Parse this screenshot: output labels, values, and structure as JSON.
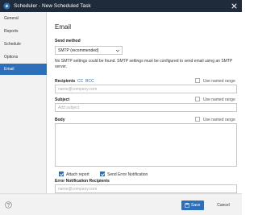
{
  "window": {
    "title": "Scheduler - New Scheduled Task"
  },
  "sidebar": {
    "items": [
      {
        "label": "General",
        "active": false
      },
      {
        "label": "Reports",
        "active": false
      },
      {
        "label": "Schedule",
        "active": false
      },
      {
        "label": "Options",
        "active": false
      },
      {
        "label": "Email",
        "active": true
      }
    ]
  },
  "main": {
    "title": "Email",
    "send_method": {
      "label": "Send method",
      "value": "SMTP (recommended)"
    },
    "warning": "No SMTP settings could be found. SMTP settings must be configured to send email using an SMTP server.",
    "recipients": {
      "label": "Recipients",
      "cc": "CC",
      "bcc": "BCC",
      "placeholder": "name@company.com",
      "named_range": "Use named range"
    },
    "subject": {
      "label": "Subject",
      "placeholder": "Add subject",
      "named_range": "Use named range"
    },
    "body": {
      "label": "Body",
      "named_range": "Use named range"
    },
    "attach_report": {
      "label": "Attach report",
      "checked": true
    },
    "send_error": {
      "label": "Send Error Notification",
      "checked": true
    },
    "error_recipients": {
      "label": "Error Notification Recipients",
      "placeholder": "name@company.com"
    }
  },
  "footer": {
    "save_label": "Save",
    "cancel_label": "Cancel"
  },
  "colors": {
    "titlebar": "#1f2b3a",
    "accent": "#2e6fba",
    "sidebar_bg": "#f2f2f2"
  }
}
